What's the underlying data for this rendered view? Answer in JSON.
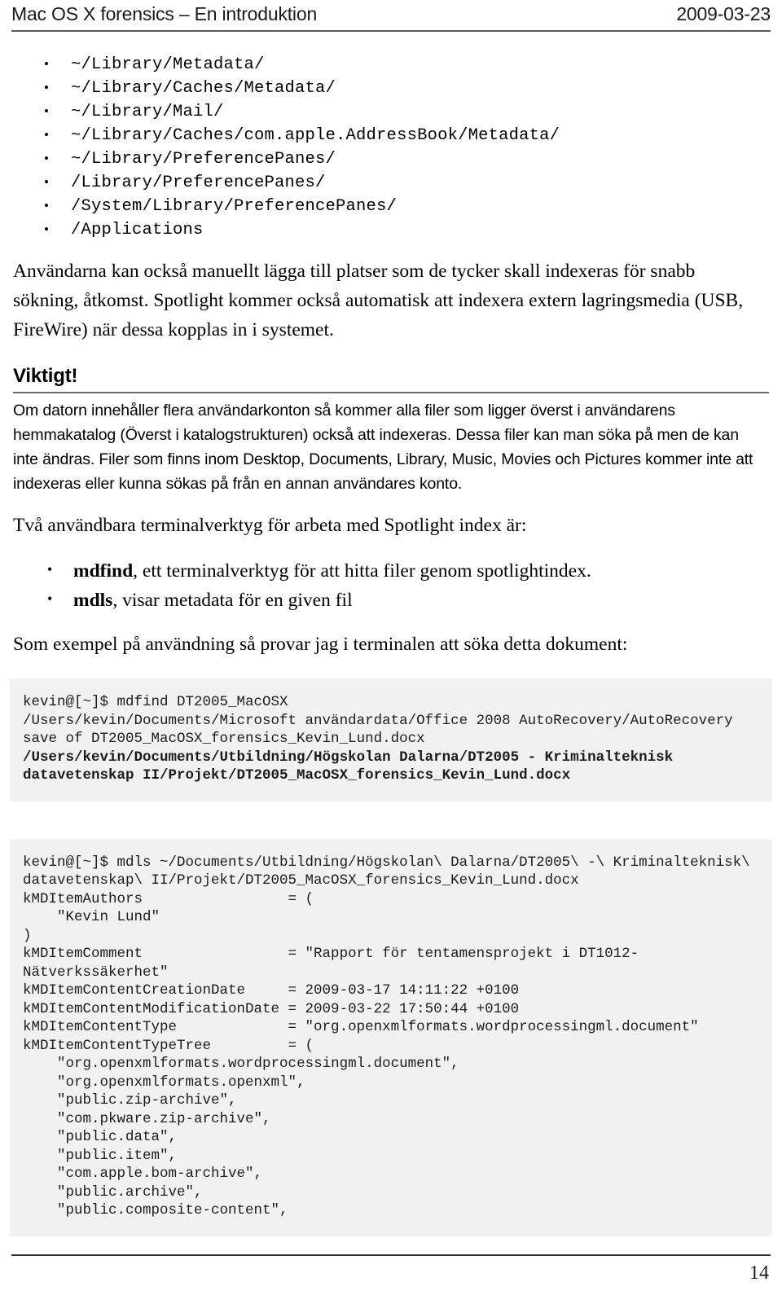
{
  "header": {
    "title": "Mac OS X forensics – En introduktion",
    "date": "2009-03-23"
  },
  "paths": [
    "~/Library/Metadata/",
    "~/Library/Caches/Metadata/",
    "~/Library/Mail/",
    "~/Library/Caches/com.apple.AddressBook/Metadata/",
    "~/Library/PreferencePanes/",
    "/Library/PreferencePanes/",
    "/System/Library/PreferencePanes/",
    "/Applications"
  ],
  "intro_paragraph": "Användarna kan också manuellt lägga till platser som de tycker skall indexeras för snabb sökning, åtkomst. Spotlight kommer också automatisk att indexera extern lagringsmedia (USB, FireWire) när dessa kopplas in i systemet.",
  "notice": {
    "heading": "Viktigt!",
    "text": "Om datorn innehåller flera användarkonton så kommer alla filer som ligger överst i användarens hemmakatalog (Överst i katalogstrukturen) också att indexeras. Dessa filer kan man söka på men de kan inte ändras. Filer som finns inom Desktop, Documents, Library, Music, Movies och Pictures kommer inte att indexeras eller kunna sökas på från en annan användares konto."
  },
  "tools_intro": "Två användbara terminalverktyg för arbeta med Spotlight index är:",
  "tools": [
    {
      "name": "mdfind",
      "description": ", ett terminalverktyg för att hitta filer genom spotlightindex."
    },
    {
      "name": "mdls",
      "description": ", visar metadata för en given fil"
    }
  ],
  "example_intro": "Som exempel på användning så provar jag i terminalen att söka detta dokument:",
  "code_mdfind": {
    "lines": [
      {
        "text": "kevin@[~]$ mdfind DT2005_MacOSX",
        "bold": false
      },
      {
        "text": "/Users/kevin/Documents/Microsoft användardata/Office 2008 AutoRecovery/AutoRecovery save of DT2005_MacOSX_forensics_Kevin_Lund.docx",
        "bold": false
      },
      {
        "text": "/Users/kevin/Documents/Utbildning/Högskolan Dalarna/DT2005 - Kriminalteknisk datavetenskap II/Projekt/DT2005_MacOSX_forensics_Kevin_Lund.docx",
        "bold": true
      }
    ]
  },
  "code_mdls": {
    "lines": [
      {
        "text": "kevin@[~]$ mdls ~/Documents/Utbildning/Högskolan\\ Dalarna/DT2005\\ -\\ Kriminalteknisk\\ datavetenskap\\ II/Projekt/DT2005_MacOSX_forensics_Kevin_Lund.docx",
        "bold": false
      },
      {
        "text": "kMDItemAuthors                 = (",
        "bold": false
      },
      {
        "text": "    \"Kevin Lund\"",
        "bold": false
      },
      {
        "text": ")",
        "bold": false
      },
      {
        "text": "kMDItemComment                 = \"Rapport för tentamensprojekt i DT1012-Nätverkssäkerhet\"",
        "bold": false
      },
      {
        "text": "kMDItemContentCreationDate     = 2009-03-17 14:11:22 +0100",
        "bold": false
      },
      {
        "text": "kMDItemContentModificationDate = 2009-03-22 17:50:44 +0100",
        "bold": false
      },
      {
        "text": "kMDItemContentType             = \"org.openxmlformats.wordprocessingml.document\"",
        "bold": false
      },
      {
        "text": "kMDItemContentTypeTree         = (",
        "bold": false
      },
      {
        "text": "    \"org.openxmlformats.wordprocessingml.document\",",
        "bold": false
      },
      {
        "text": "    \"org.openxmlformats.openxml\",",
        "bold": false
      },
      {
        "text": "    \"public.zip-archive\",",
        "bold": false
      },
      {
        "text": "    \"com.pkware.zip-archive\",",
        "bold": false
      },
      {
        "text": "    \"public.data\",",
        "bold": false
      },
      {
        "text": "    \"public.item\",",
        "bold": false
      },
      {
        "text": "    \"com.apple.bom-archive\",",
        "bold": false
      },
      {
        "text": "    \"public.archive\",",
        "bold": false
      },
      {
        "text": "    \"public.composite-content\",",
        "bold": false
      }
    ]
  },
  "footer": {
    "page_number": "14"
  }
}
